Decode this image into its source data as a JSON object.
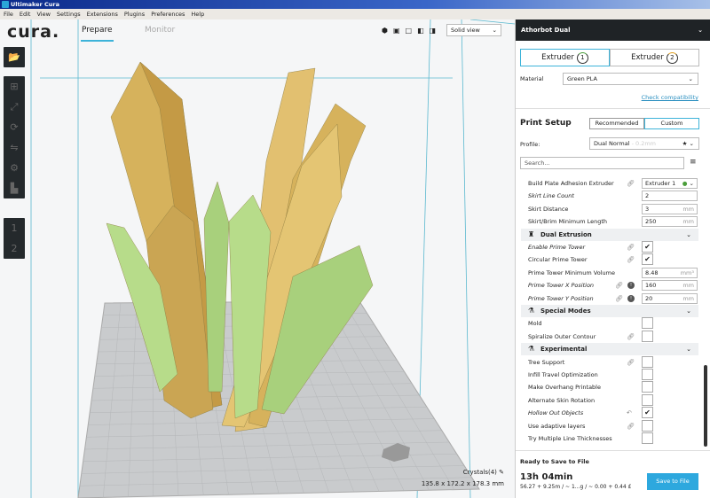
{
  "window": {
    "title": "Ultimaker Cura"
  },
  "menu": [
    "File",
    "Edit",
    "View",
    "Settings",
    "Extensions",
    "Plugins",
    "Preferences",
    "Help"
  ],
  "header": {
    "logo": "cura.",
    "tabs": [
      "Prepare",
      "Monitor"
    ],
    "active_tab": "Prepare",
    "view_mode": "Solid view"
  },
  "left_toolbar": {
    "icons": [
      "open-file-icon",
      "move-icon",
      "scale-icon",
      "rotate-icon",
      "mirror-icon",
      "per-model-settings-icon",
      "support-blocker-icon",
      "extruder-1-icon",
      "extruder-2-icon"
    ],
    "extruder_labels": [
      "1",
      "2"
    ]
  },
  "model_info": {
    "name": "Crystals(4)",
    "dimensions": "135.8 x 172.2 x 178.3 mm"
  },
  "panel": {
    "printer": "Athorbot Dual",
    "extruders": [
      {
        "label": "Extruder",
        "num": "1"
      },
      {
        "label": "Extruder",
        "num": "2"
      }
    ],
    "material_label": "Material",
    "material": "Green PLA",
    "check_compat": "Check compatibility",
    "print_setup": "Print Setup",
    "recommended": "Recommended",
    "custom": "Custom",
    "profile_label": "Profile:",
    "profile": "Dual Normal",
    "profile_sub": "- 0.2mm",
    "search_placeholder": "Search...",
    "settings": [
      {
        "name": "Build Plate Adhesion Extruder",
        "value": "Extruder 1",
        "link": true,
        "type": "select"
      },
      {
        "name": "Skirt Line Count",
        "italic": true,
        "value": "2",
        "type": "text"
      },
      {
        "name": "Skirt Distance",
        "value": "3",
        "unit": "mm",
        "type": "text"
      },
      {
        "name": "Skirt/Brim Minimum Length",
        "value": "250",
        "unit": "mm",
        "type": "text"
      }
    ],
    "cat_dual": "Dual Extrusion",
    "dual": [
      {
        "name": "Enable Prime Tower",
        "italic": true,
        "link": true,
        "checked": true
      },
      {
        "name": "Circular Prime Tower",
        "link": true,
        "checked": true
      },
      {
        "name": "Prime Tower Minimum Volume",
        "value": "8.48",
        "unit": "mm³"
      },
      {
        "name": "Prime Tower X Position",
        "italic": true,
        "link": true,
        "info": true,
        "value": "160",
        "unit": "mm"
      },
      {
        "name": "Prime Tower Y Position",
        "italic": true,
        "link": true,
        "info": true,
        "value": "20",
        "unit": "mm"
      }
    ],
    "cat_special": "Special Modes",
    "special": [
      {
        "name": "Mold",
        "checked": false
      },
      {
        "name": "Spiralize Outer Contour",
        "link": true,
        "checked": false
      }
    ],
    "cat_exp": "Experimental",
    "exp": [
      {
        "name": "Tree Support",
        "link": true,
        "checked": false
      },
      {
        "name": "Infill Travel Optimization",
        "checked": false
      },
      {
        "name": "Make Overhang Printable",
        "checked": false
      },
      {
        "name": "Alternate Skin Rotation",
        "checked": false
      },
      {
        "name": "Hollow Out Objects",
        "italic": true,
        "reset": true,
        "checked": true
      },
      {
        "name": "Use adaptive layers",
        "link": true,
        "checked": false
      },
      {
        "name": "Try Multiple Line Thicknesses",
        "checked": false
      }
    ],
    "ready": "Ready to Save to File",
    "time": "13h 04min",
    "estimate": "56.27 + 9.25m / ~ 1...g / ~ 0.00 + 0.44 £",
    "save": "Save to File",
    "colors": {
      "accent": "#2da8de",
      "extruder1": "#4a9e3a",
      "extruder2": "#e0a020"
    }
  }
}
